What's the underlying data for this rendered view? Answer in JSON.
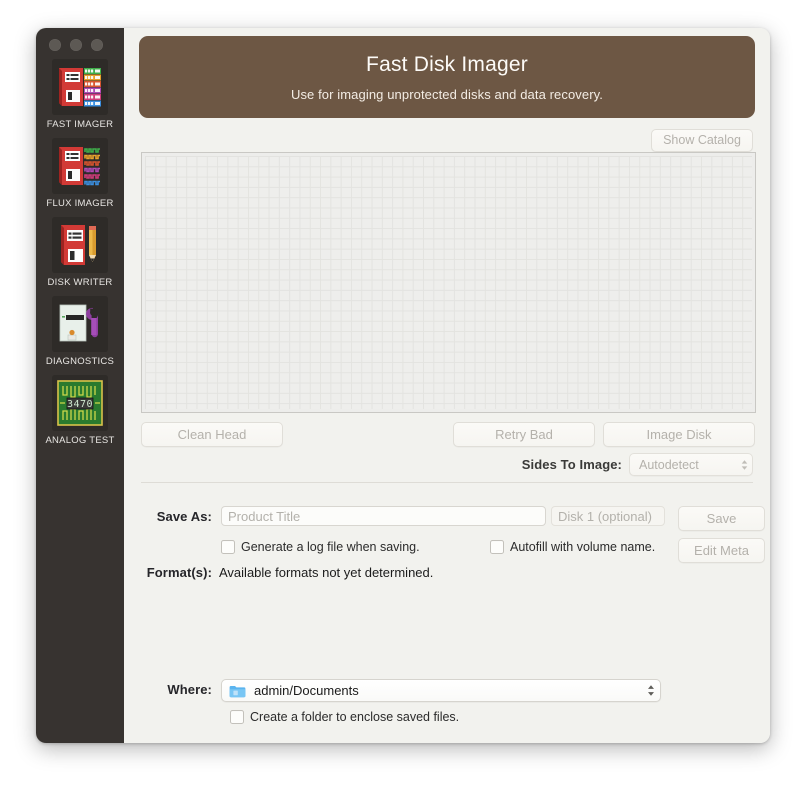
{
  "window": {
    "traffic_lights": [
      "close",
      "minimize",
      "zoom"
    ]
  },
  "sidebar": {
    "items": [
      {
        "id": "fast-imager",
        "label": "FAST IMAGER",
        "icon": "red-floppy-data-blocks-icon",
        "selected": true
      },
      {
        "id": "flux-imager",
        "label": "FLUX IMAGER",
        "icon": "red-floppy-waveform-icon",
        "selected": false
      },
      {
        "id": "disk-writer",
        "label": "DISK WRITER",
        "icon": "red-floppy-pencil-icon",
        "selected": false
      },
      {
        "id": "diagnostics",
        "label": "DIAGNOSTICS",
        "icon": "drive-wrench-icon",
        "selected": false
      },
      {
        "id": "analog-test",
        "label": "ANALOG TEST",
        "icon": "circuit-board-icon",
        "selected": false
      }
    ]
  },
  "banner": {
    "title": "Fast Disk Imager",
    "subtitle": "Use for imaging unprotected disks and data recovery.",
    "background_color": "#6d5744"
  },
  "catalog": {
    "show_catalog_label": "Show Catalog"
  },
  "track_map": {
    "columns": 59,
    "rows": 25
  },
  "actions": {
    "clean_head_label": "Clean Head",
    "retry_bad_label": "Retry Bad",
    "image_disk_label": "Image Disk"
  },
  "sides": {
    "label": "Sides To Image:",
    "value": "Autodetect",
    "options": [
      "Autodetect"
    ]
  },
  "save": {
    "save_as_label": "Save As:",
    "product_title_placeholder": "Product Title",
    "product_title_value": "",
    "disk_number_placeholder": "Disk 1 (optional)",
    "disk_number_value": "",
    "save_button_label": "Save",
    "edit_meta_button_label": "Edit Meta",
    "log_checkbox_label": "Generate a log file when saving.",
    "log_checkbox_checked": false,
    "autofill_checkbox_label": "Autofill with volume name.",
    "autofill_checkbox_checked": false
  },
  "format": {
    "label": "Format(s):",
    "value": "Available formats not yet determined."
  },
  "where": {
    "label": "Where:",
    "value": "admin/Documents",
    "folder_icon": "blue-folder-icon",
    "enclose_checkbox_label": "Create a folder to enclose saved files.",
    "enclose_checkbox_checked": false
  },
  "colors": {
    "window_background": "#f2f2ee",
    "sidebar_background": "#373330",
    "banner": "#6d5744",
    "accent_folder": "#63b9ef"
  }
}
